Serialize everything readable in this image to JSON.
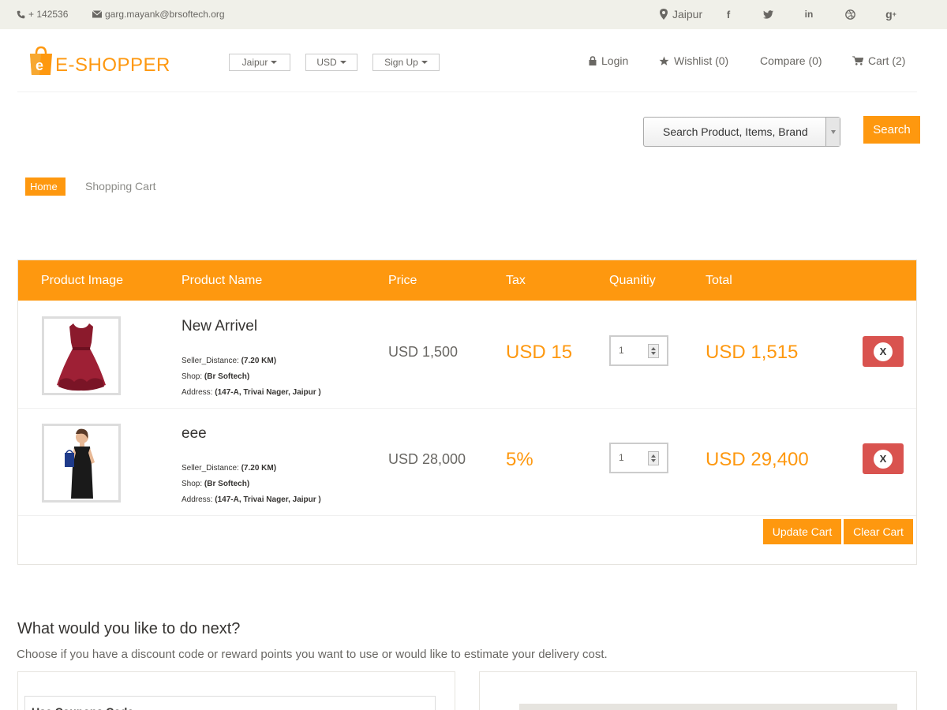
{
  "topbar": {
    "phone": "+ 142536",
    "email": "garg.mayank@brsoftech.org",
    "location": "Jaipur",
    "social_icons": [
      "facebook-icon",
      "twitter-icon",
      "linkedin-icon",
      "dribbble-icon",
      "google-plus-icon"
    ]
  },
  "header": {
    "logo_letter": "e",
    "logo_text": "E-SHOPPER",
    "dropdowns": [
      "Jaipur",
      "USD",
      "Sign Up"
    ],
    "login": "Login",
    "wishlist": "Wishlist (0)",
    "compare": "Compare (0)",
    "cart": "Cart (2)"
  },
  "search": {
    "placeholder": "Search Product, Items, Brand",
    "button": "Search"
  },
  "breadcrumb": {
    "home": "Home",
    "current": "Shopping Cart"
  },
  "cart": {
    "columns": [
      "Product Image",
      "Product Name",
      "Price",
      "Tax",
      "Quanitiy",
      "Total"
    ],
    "items": [
      {
        "name": "New Arrivel",
        "seller_label": "Seller_Distance:",
        "seller_value": "(7.20 KM)",
        "shop_label": "Shop:",
        "shop_value": "(Br Softech)",
        "address_label": "Address:",
        "address_value": "(147-A, Trivai Nager, Jaipur )",
        "price": "USD 1,500",
        "tax": "USD 15",
        "qty": "1",
        "total": "USD 1,515",
        "remove": "X"
      },
      {
        "name": "eee",
        "seller_label": "Seller_Distance:",
        "seller_value": "(7.20 KM)",
        "shop_label": "Shop:",
        "shop_value": "(Br Softech)",
        "address_label": "Address:",
        "address_value": "(147-A, Trivai Nager, Jaipur )",
        "price": "USD 28,000",
        "tax": "5%",
        "qty": "1",
        "total": "USD 29,400",
        "remove": "X"
      }
    ],
    "update_button": "Update Cart",
    "clear_button": "Clear Cart"
  },
  "next": {
    "title": "What would you like to do next?",
    "subtitle": "Choose if you have a discount code or reward points you want to use or would like to estimate your delivery cost.",
    "coupon_heading": "Use Coupons Code"
  },
  "colors": {
    "accent": "#fe980f",
    "danger": "#d9534f",
    "topbar": "#f0f0e9"
  }
}
